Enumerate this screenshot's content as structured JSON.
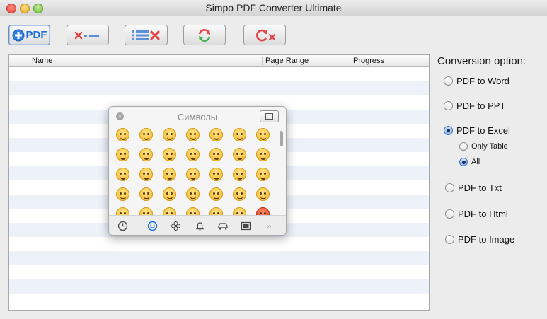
{
  "window": {
    "title": "Simpo PDF Converter Ultimate"
  },
  "toolbar": {
    "add_pdf_label": "PDF",
    "add_pdf_icon": "plus-circle-icon",
    "remove_icon": "remove-item-icon",
    "clear_list_icon": "clear-list-icon",
    "convert_icon": "refresh-icon",
    "stop_icon": "stop-refresh-icon"
  },
  "file_table": {
    "columns": [
      "Name",
      "Page Range",
      "Progress"
    ],
    "rows": []
  },
  "conversion": {
    "title": "Conversion option:",
    "options": [
      {
        "label": "PDF to Word",
        "selected": false
      },
      {
        "label": "PDF to PPT",
        "selected": false
      },
      {
        "label": "PDF to Excel",
        "selected": true
      },
      {
        "label": "PDF to Txt",
        "selected": false
      },
      {
        "label": "PDF to Html",
        "selected": false
      },
      {
        "label": "PDF to Image",
        "selected": false
      }
    ],
    "excel_suboptions": [
      {
        "label": "Only Table",
        "selected": false
      },
      {
        "label": "All",
        "selected": true
      }
    ]
  },
  "symbols_palette": {
    "title": "Символы",
    "close_icon": "close-icon",
    "keyboard_icon": "keyboard-viewer-icon",
    "category_tabs": [
      "clock-icon",
      "smiley-icon",
      "flower-icon",
      "bell-icon",
      "car-icon",
      "number-icon",
      "more-chevron-icon"
    ],
    "active_tab": "smiley-icon",
    "emoji_rows": [
      [
        "grinning",
        "smiley",
        "smile",
        "blush",
        "relaxed",
        "wink",
        "heart-eyes"
      ],
      [
        "kissing-heart",
        "kissing-closed-eyes",
        "kissing",
        "kissing-smiling-eyes",
        "stuck-out-tongue-winking",
        "stuck-out-tongue-closed-eyes",
        "stuck-out-tongue"
      ],
      [
        "flushed",
        "grin",
        "pensive",
        "relieved",
        "unamused",
        "disappointed",
        "persevere"
      ],
      [
        "cry",
        "joy",
        "sob",
        "sleepy",
        "disappointed-relieved",
        "cold-sweat",
        "sweat-smile"
      ],
      [
        "sweat",
        "weary",
        "tired-face",
        "fearful",
        "scream",
        "angry",
        "rage"
      ]
    ]
  }
}
